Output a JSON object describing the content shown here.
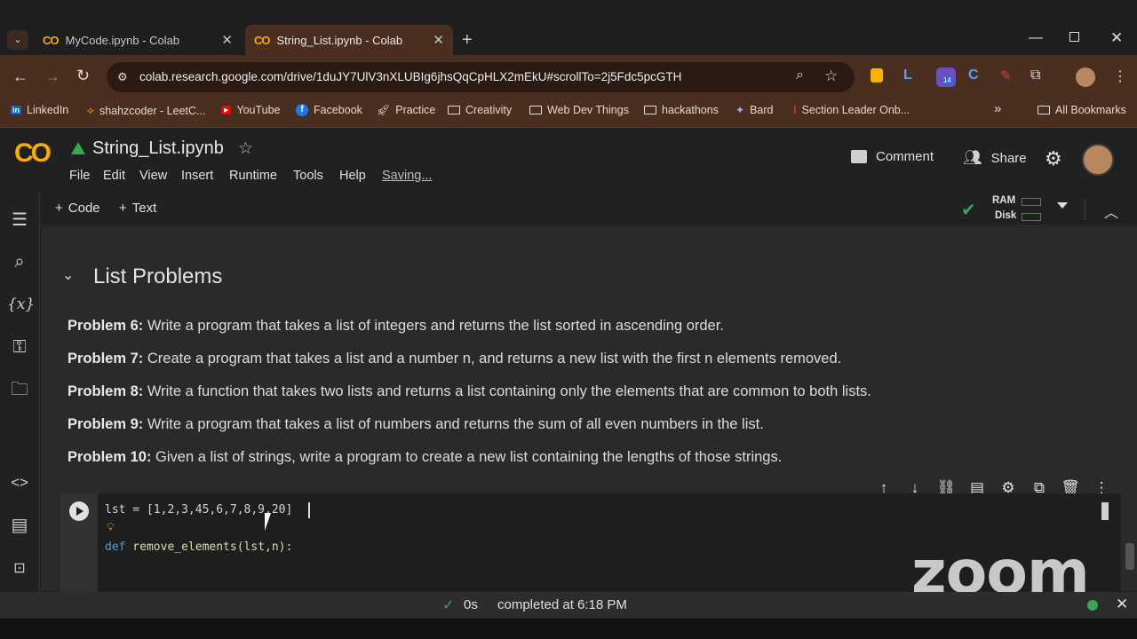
{
  "browser": {
    "tabs": [
      {
        "title": "MyCode.ipynb - Colab",
        "logo": "CO"
      },
      {
        "title": "String_List.ipynb - Colab",
        "logo": "CO"
      }
    ],
    "url": "colab.research.google.com/drive/1duJY7UlV3nXLUBIg6jhsQqCpHLX2mEkU#scrollTo=2j5Fdc5pcGTH",
    "extension_badge": "14",
    "bookmarks": [
      "LinkedIn",
      "shahzcoder - LeetC...",
      "YouTube",
      "Facebook",
      "Practice",
      "Creativity",
      "Web Dev Things",
      "hackathons",
      "Bard",
      "Section Leader Onb..."
    ],
    "overflow": "»",
    "all_bookmarks": "All Bookmarks"
  },
  "colab": {
    "logo": "CO",
    "title": "String_List.ipynb",
    "menu": [
      "File",
      "Edit",
      "View",
      "Insert",
      "Runtime",
      "Tools",
      "Help"
    ],
    "saving": "Saving...",
    "comment_label": "Comment",
    "share_label": "Share",
    "add_code": "Code",
    "add_text": "Text",
    "ram_label": "RAM",
    "disk_label": "Disk"
  },
  "section": {
    "heading": "List Problems",
    "problems": [
      {
        "label": "Problem 6:",
        "text": " Write a program that takes a list of integers and returns the list sorted in ascending order."
      },
      {
        "label": "Problem 7:",
        "text": " Create a program that takes a list and a number n, and returns a new list with the first n elements removed."
      },
      {
        "label": "Problem 8:",
        "text": " Write a function that takes two lists and returns a list containing only the elements that are common to both lists."
      },
      {
        "label": "Problem 9:",
        "text": " Write a program that takes a list of numbers and returns the sum of all even numbers in the list."
      },
      {
        "label": "Problem 10:",
        "text": " Given a list of strings, write a program to create a new list containing the lengths of those strings."
      }
    ]
  },
  "code": {
    "line1": "lst = [1,2,3,45,6,7,8,9,20]",
    "line2_kw": "def",
    "line2_rest": " remove_elements(lst,n):"
  },
  "status": {
    "duration": "0s",
    "completed": "completed at 6:18 PM"
  },
  "watermark": "zoom"
}
